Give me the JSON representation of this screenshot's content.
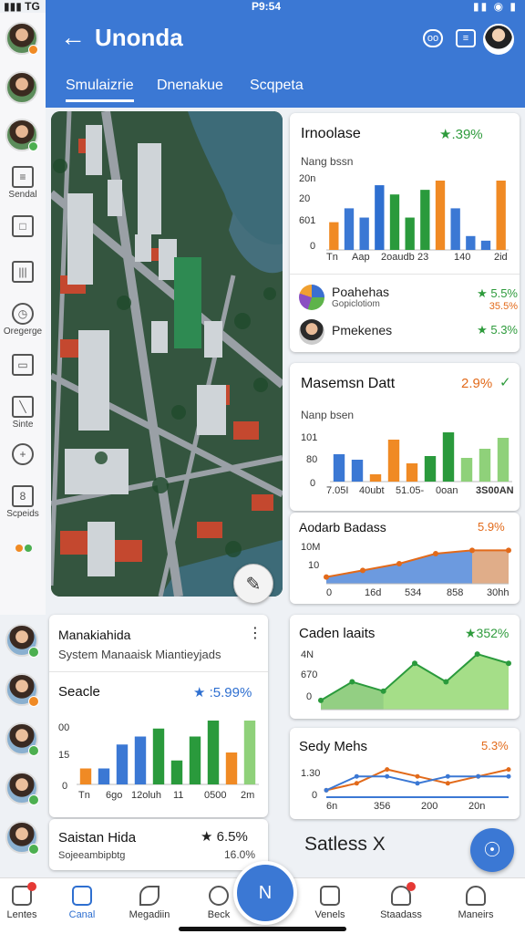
{
  "status": {
    "signal": "▮▮▮ TG",
    "time": "P9:54",
    "right": "▮▮ ◉ ▮"
  },
  "header": {
    "title": "Unonda",
    "back_icon": "back-arrow-icon",
    "tabs": [
      "Smulaizrie",
      "Dnenakue",
      "Scqpeta"
    ],
    "accent": "#3b78d4"
  },
  "rail": {
    "items": [
      {
        "label": "Sendal",
        "icon": "document-icon"
      },
      {
        "label": "",
        "icon": "cube-icon"
      },
      {
        "label": "",
        "icon": "bars-icon"
      },
      {
        "label": "Oregerge",
        "icon": "clock-icon"
      },
      {
        "label": "",
        "icon": "folder-icon"
      },
      {
        "label": "Sinte",
        "icon": "ruler-icon"
      },
      {
        "label": "",
        "icon": "compass-icon"
      },
      {
        "label": "Scpeids",
        "icon": "calendar-icon"
      }
    ]
  },
  "cards": {
    "c1": {
      "title": "Irnoolase",
      "pct": "★.39%",
      "sub": "Nang bssn",
      "yticks": [
        "20n",
        "20",
        "601",
        "0"
      ],
      "xticks": [
        "Tn",
        "Aap",
        "2oaudb",
        "23",
        "140",
        "2id"
      ],
      "rows": [
        {
          "name": "Poahehas",
          "sub": "Gopiclotiom",
          "val": "★ 5.5%",
          "val2": "35.5%"
        },
        {
          "name": "Pmekenes",
          "sub": "",
          "val": "★ 5.3%",
          "val2": ""
        }
      ]
    },
    "c2": {
      "title": "Masemsn Datt",
      "pct": "2.9%",
      "sub": "Nanp bsen",
      "yticks": [
        "101",
        "80",
        "0"
      ],
      "xticks": [
        "7.05I",
        "40ubt",
        "51.05-",
        "0oan",
        "3S00AN"
      ]
    },
    "c3": {
      "title": "Aodarb Badass",
      "pct": "5.9%",
      "yticks": [
        "10M",
        "10",
        "0"
      ],
      "xticks": [
        "0",
        "16d",
        "534",
        "858",
        "30hh"
      ]
    },
    "c4": {
      "title": "Caden laaits",
      "pct": "★352%",
      "yticks": [
        "4N",
        "670",
        "0"
      ]
    },
    "c5": {
      "title": "Sedy Mehs",
      "pct": "5.3%",
      "yticks": [
        "1.30",
        "0"
      ],
      "xticks": [
        "6n",
        "356",
        "200",
        "20n"
      ]
    },
    "left1": {
      "title": "Manakiahida",
      "subtitle": "System Manaaisk Miantieyjads",
      "section": "Seacle",
      "pct": "★ :5.99%",
      "yticks": [
        "00",
        "15",
        "0"
      ],
      "xticks": [
        "Tn",
        "6go",
        "12oluh",
        "11",
        "0500",
        "2m"
      ]
    },
    "left2": {
      "title": "Saistan Hida",
      "pct": "★ 6.5%",
      "sub": "Sojeeambipbtg",
      "val2": "16.0%"
    }
  },
  "footer_text": "Satless X",
  "bottom_nav": [
    {
      "label": "Lentes",
      "icon": "chat-icon"
    },
    {
      "label": "Canal",
      "icon": "channel-icon"
    },
    {
      "label": "Megadiin",
      "icon": "leaf-icon"
    },
    {
      "label": "Beck",
      "icon": "bulb-icon"
    },
    {
      "label": "Venels",
      "icon": "list-icon"
    },
    {
      "label": "Staadass",
      "icon": "heart-icon"
    },
    {
      "label": "Maneirs",
      "icon": "person-icon"
    }
  ],
  "chart_data": [
    {
      "type": "bar",
      "title": "Irnoolase",
      "values": [
        6,
        9,
        7,
        14,
        12,
        7,
        13,
        15,
        9,
        3,
        2,
        15
      ]
    },
    {
      "type": "bar",
      "title": "Masemsn Datt",
      "values": [
        30,
        24,
        8,
        46,
        20,
        28,
        54,
        26,
        36,
        48
      ]
    },
    {
      "type": "area",
      "title": "Aodarb Badass",
      "values": [
        2,
        4,
        6,
        9,
        10,
        10
      ]
    },
    {
      "type": "area",
      "title": "Caden laaits",
      "values": [
        1,
        3,
        2,
        5,
        3,
        6,
        5
      ]
    },
    {
      "type": "line",
      "title": "Sedy Mehs",
      "series": [
        {
          "values": [
            1,
            2,
            4,
            3,
            2,
            3,
            4
          ]
        },
        {
          "values": [
            1,
            3,
            3,
            2,
            3,
            3,
            3
          ]
        }
      ]
    },
    {
      "type": "bar",
      "title": "Seacle",
      "values": [
        2,
        2,
        5,
        6,
        7,
        3,
        6,
        8,
        4,
        8
      ]
    }
  ]
}
